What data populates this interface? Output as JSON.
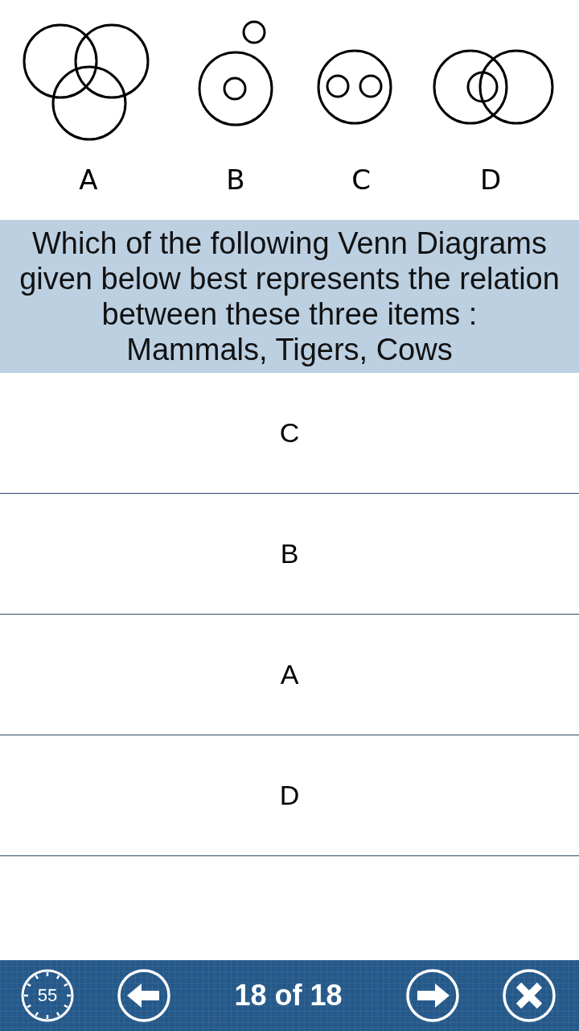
{
  "figure": {
    "diagrams": [
      {
        "label": "A",
        "kind": "three-overlap"
      },
      {
        "label": "B",
        "kind": "nested-with-outside"
      },
      {
        "label": "C",
        "kind": "two-inside"
      },
      {
        "label": "D",
        "kind": "overlap-with-inner"
      }
    ]
  },
  "question": {
    "text": "Which of the following Venn Diagrams\ngiven below best represents the relation\nbetween these three items :\nMammals, Tigers, Cows"
  },
  "options": [
    {
      "label": "C",
      "selected": false
    },
    {
      "label": "B",
      "selected": false
    },
    {
      "label": "A",
      "selected": false
    },
    {
      "label": "D",
      "selected": false
    }
  ],
  "toolbar": {
    "timer": "55",
    "progress": "18 of 18"
  }
}
